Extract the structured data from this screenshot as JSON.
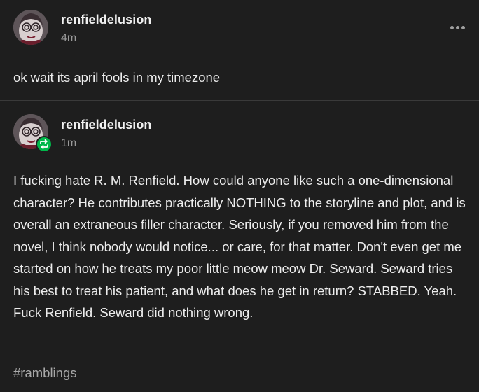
{
  "posts": [
    {
      "username": "renfieldelusion",
      "timestamp": "4m",
      "body": "ok wait its april fools in my timezone"
    },
    {
      "username": "renfieldelusion",
      "timestamp": "1m",
      "reblogged": true,
      "body": "I fucking hate R. M. Renfield. How could anyone like such a one-dimensional character? He contributes practically NOTHING to the storyline and plot, and is overall an extraneous filler character. Seriously, if you removed him from the novel, I think nobody would notice... or care, for that matter. Don't even get me started on how he treats my poor little meow meow Dr. Seward. Seward tries his best to treat his patient, and what does he get in return? STABBED. Yeah. Fuck Renfield. Seward did nothing wrong.",
      "tags": [
        "#ramblings"
      ]
    }
  ],
  "icons": {
    "more": "more-horizontal-icon",
    "reblog": "reblog-icon"
  },
  "colors": {
    "background": "#1e1e1e",
    "reblog_badge": "#00b84a",
    "muted_text": "#9b9b9b"
  }
}
